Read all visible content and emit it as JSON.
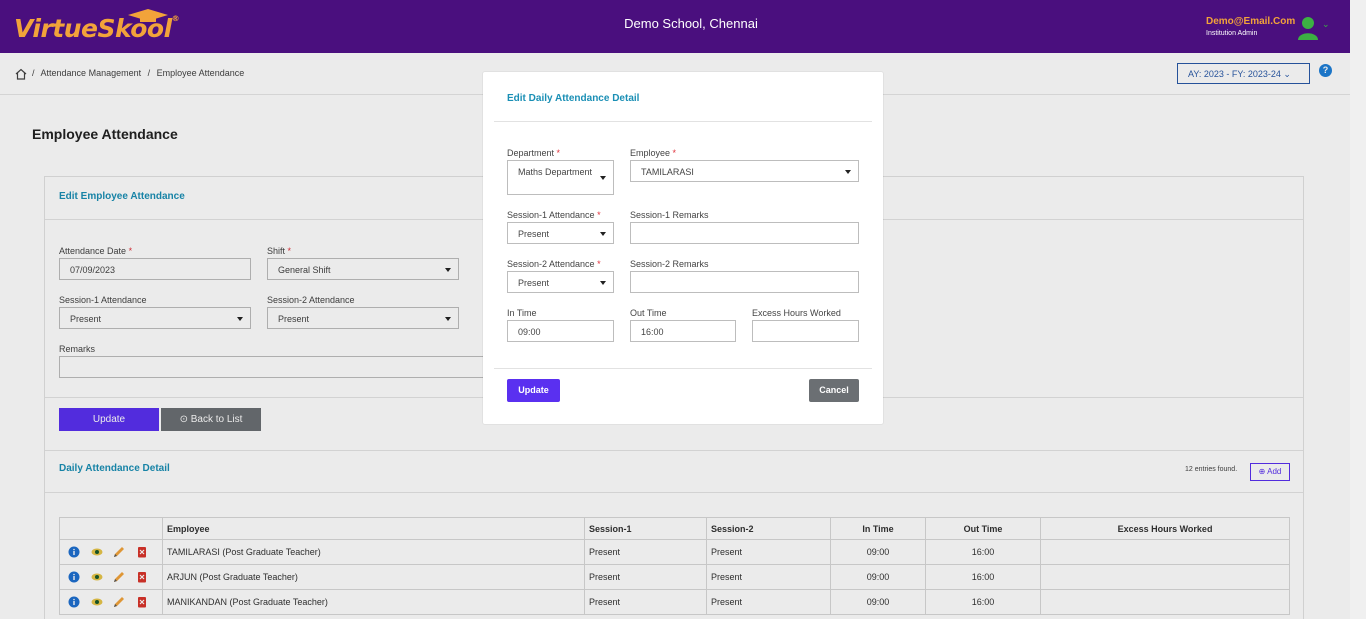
{
  "header": {
    "logo_text": "VirtueSkool",
    "logo_mark": "®",
    "school_name": "Demo School, Chennai",
    "user_email": "Demo@Email.Com",
    "user_role": "Institution Admin"
  },
  "breadcrumb": {
    "items": [
      "Attendance Management",
      "Employee Attendance"
    ],
    "separator": "/"
  },
  "academic_year": "AY: 2023 - FY: 2023-24",
  "help_label": "?",
  "page_title": "Employee Attendance",
  "edit_form": {
    "title": "Edit Employee Attendance",
    "attendance_date_label": "Attendance Date",
    "attendance_date": "07/09/2023",
    "shift_label": "Shift",
    "shift": "General Shift",
    "session1_label": "Session-1 Attendance",
    "session1": "Present",
    "session2_label": "Session-2 Attendance",
    "session2": "Present",
    "remarks_label": "Remarks",
    "update_label": "Update",
    "back_label": "Back to List"
  },
  "daily_detail": {
    "title": "Daily Attendance Detail",
    "entries_found": "12 entries found.",
    "add_label": "Add",
    "columns": [
      "Employee",
      "Session-1",
      "Session-2",
      "In Time",
      "Out Time",
      "Excess Hours Worked"
    ],
    "rows": [
      {
        "employee": "TAMILARASI (Post Graduate Teacher)",
        "s1": "Present",
        "s2": "Present",
        "in": "09:00",
        "out": "16:00",
        "excess": ""
      },
      {
        "employee": "ARJUN (Post Graduate Teacher)",
        "s1": "Present",
        "s2": "Present",
        "in": "09:00",
        "out": "16:00",
        "excess": ""
      },
      {
        "employee": "MANIKANDAN (Post Graduate Teacher)",
        "s1": "Present",
        "s2": "Present",
        "in": "09:00",
        "out": "16:00",
        "excess": ""
      }
    ]
  },
  "modal": {
    "title": "Edit Daily Attendance Detail",
    "department_label": "Department",
    "department": "Maths Department",
    "employee_label": "Employee",
    "employee": "TAMILARASI",
    "s1_label": "Session-1 Attendance",
    "s1": "Present",
    "s1_remarks_label": "Session-1 Remarks",
    "s1_remarks": "",
    "s2_label": "Session-2 Attendance",
    "s2": "Present",
    "s2_remarks_label": "Session-2 Remarks",
    "s2_remarks": "",
    "in_time_label": "In Time",
    "in_time": "09:00",
    "out_time_label": "Out Time",
    "out_time": "16:00",
    "excess_label": "Excess Hours Worked",
    "excess": "",
    "update_label": "Update",
    "cancel_label": "Cancel",
    "required_mark": "*"
  },
  "colors": {
    "header_bg": "#4a0f7e",
    "accent_orange": "#f2a33a",
    "primary": "#5a30f0",
    "link": "#1a8fb5",
    "secondary": "#6b6f73"
  }
}
